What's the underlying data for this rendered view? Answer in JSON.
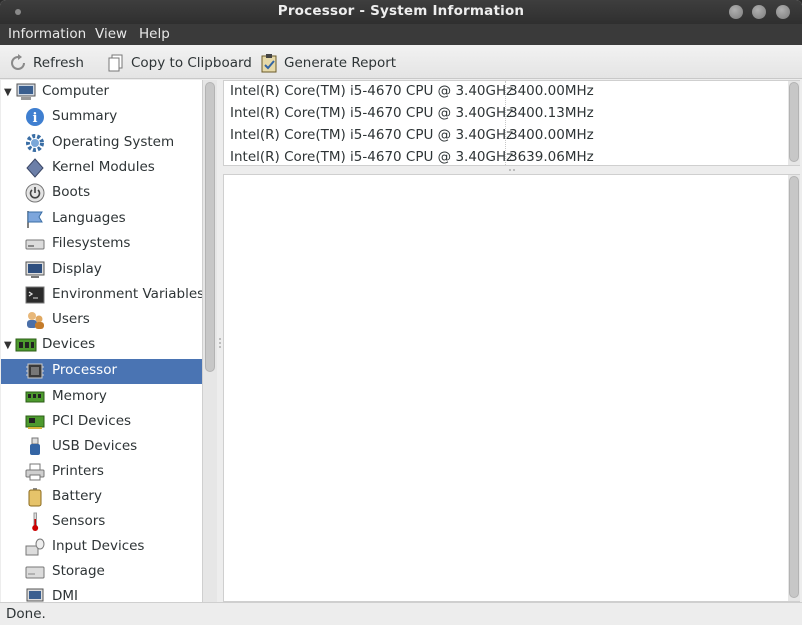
{
  "window": {
    "title": "Processor - System Information"
  },
  "menu": [
    "Information",
    "View",
    "Help"
  ],
  "toolbar": {
    "refresh": "Refresh",
    "copy": "Copy to Clipboard",
    "report": "Generate Report"
  },
  "sidebar": {
    "computer": {
      "label": "Computer",
      "items": [
        "Summary",
        "Operating System",
        "Kernel Modules",
        "Boots",
        "Languages",
        "Filesystems",
        "Display",
        "Environment Variables",
        "Users"
      ]
    },
    "devices": {
      "label": "Devices",
      "items": [
        "Processor",
        "Memory",
        "PCI Devices",
        "USB Devices",
        "Printers",
        "Battery",
        "Sensors",
        "Input Devices",
        "Storage",
        "DMI"
      ]
    },
    "selected": "Processor"
  },
  "processors": [
    {
      "name": "Intel(R) Core(TM) i5-4670 CPU @ 3.40GHz",
      "freq": "3400.00MHz"
    },
    {
      "name": "Intel(R) Core(TM) i5-4670 CPU @ 3.40GHz",
      "freq": "3400.13MHz"
    },
    {
      "name": "Intel(R) Core(TM) i5-4670 CPU @ 3.40GHz",
      "freq": "3400.00MHz"
    },
    {
      "name": "Intel(R) Core(TM) i5-4670 CPU @ 3.40GHz",
      "freq": "3639.06MHz"
    }
  ],
  "status": "Done.",
  "colors": {
    "selection": "#4a74b3",
    "titlebar": "#3a3a3a",
    "menubar": "#3a3a3a"
  }
}
